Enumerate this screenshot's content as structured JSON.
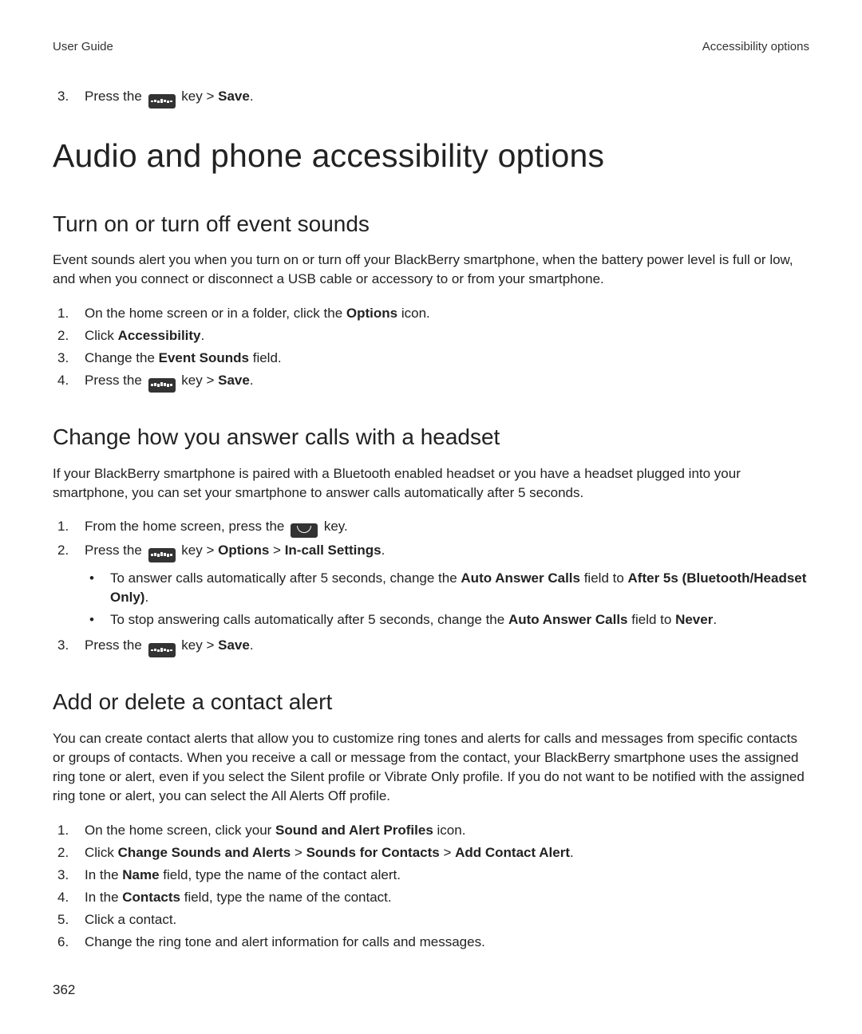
{
  "header": {
    "left": "User Guide",
    "right": "Accessibility options"
  },
  "top_step": {
    "number": "3.",
    "before_icon": "Press the ",
    "after_icon": " key > ",
    "bold1": "Save",
    "period": "."
  },
  "h1": "Audio and phone accessibility options",
  "sec1": {
    "title": "Turn on or turn off event sounds",
    "intro": "Event sounds alert you when you turn on or turn off your BlackBerry smartphone, when the battery power level is full or low, and when you connect or disconnect a USB cable or accessory to or from your smartphone.",
    "step1_a": "On the home screen or in a folder, click the ",
    "step1_b": "Options",
    "step1_c": " icon.",
    "step2_a": "Click ",
    "step2_b": "Accessibility",
    "step2_c": ".",
    "step3_a": "Change the ",
    "step3_b": "Event Sounds",
    "step3_c": " field.",
    "step4_a": "Press the ",
    "step4_b": " key > ",
    "step4_c": "Save",
    "step4_d": "."
  },
  "sec2": {
    "title": "Change how you answer calls with a headset",
    "intro": "If your BlackBerry smartphone is paired with a Bluetooth enabled headset or you have a headset plugged into your smartphone, you can set your smartphone to answer calls automatically after 5 seconds.",
    "step1_a": "From the home screen, press the ",
    "step1_b": " key.",
    "step2_a": "Press the ",
    "step2_b": " key > ",
    "step2_c": "Options",
    "step2_d": " > ",
    "step2_e": "In-call Settings",
    "step2_f": ".",
    "bullet1_a": "To answer calls automatically after 5 seconds, change the ",
    "bullet1_b": "Auto Answer Calls",
    "bullet1_c": " field to ",
    "bullet1_d": "After 5s (Bluetooth/Headset Only)",
    "bullet1_e": ".",
    "bullet2_a": "To stop answering calls automatically after 5 seconds, change the ",
    "bullet2_b": "Auto Answer Calls",
    "bullet2_c": " field to ",
    "bullet2_d": "Never",
    "bullet2_e": ".",
    "step3_a": "Press the ",
    "step3_b": " key > ",
    "step3_c": "Save",
    "step3_d": "."
  },
  "sec3": {
    "title": "Add or delete a contact alert",
    "intro": "You can create contact alerts that allow you to customize ring tones and alerts for calls and messages from specific contacts or groups of contacts. When you receive a call or message from the contact, your BlackBerry smartphone uses the assigned ring tone or alert, even if you select the Silent profile or Vibrate Only profile. If you do not want to be notified with the assigned ring tone or alert, you can select the All Alerts Off profile.",
    "step1_a": "On the home screen, click your ",
    "step1_b": "Sound and Alert Profiles",
    "step1_c": " icon.",
    "step2_a": "Click ",
    "step2_b": "Change Sounds and Alerts",
    "step2_c": " > ",
    "step2_d": "Sounds for Contacts",
    "step2_e": " > ",
    "step2_f": "Add Contact Alert",
    "step2_g": ".",
    "step3_a": "In the ",
    "step3_b": "Name",
    "step3_c": " field, type the name of the contact alert.",
    "step4_a": "In the ",
    "step4_b": "Contacts",
    "step4_c": " field, type the name of the contact.",
    "step5": "Click a contact.",
    "step6": "Change the ring tone and alert information for calls and messages."
  },
  "page_number": "362"
}
